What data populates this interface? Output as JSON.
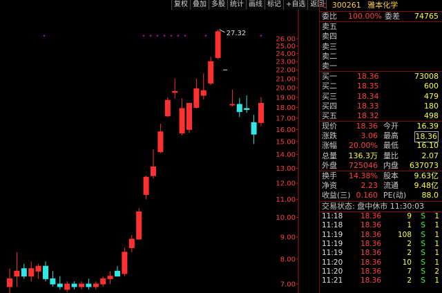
{
  "toolbar": [
    "复权",
    "叠加",
    "多股",
    "统计",
    "画线",
    "标记",
    "+自选",
    "返回"
  ],
  "chart_data": {
    "type": "candlestick",
    "y_ticks": [
      26.0,
      25.0,
      24.0,
      23.0,
      22.0,
      21.0,
      20.0,
      19.0,
      18.0,
      17.0,
      16.0,
      15.0,
      14.0,
      13.0,
      12.0,
      11.0,
      10.0,
      9.0,
      8.0,
      7.0
    ],
    "peak_label": "27.32",
    "candles": [
      {
        "o": 6.9,
        "h": 7.6,
        "l": 6.6,
        "c": 7.2
      },
      {
        "o": 7.3,
        "h": 8.3,
        "l": 6.9,
        "c": 7.5
      },
      {
        "o": 7.6,
        "h": 7.8,
        "l": 7.2,
        "c": 7.3
      },
      {
        "o": 7.3,
        "h": 7.9,
        "l": 7.1,
        "c": 7.6
      },
      {
        "o": 7.5,
        "h": 7.8,
        "l": 7.2,
        "c": 7.7
      },
      {
        "o": 7.7,
        "h": 7.9,
        "l": 7.1,
        "c": 7.2
      },
      {
        "o": 7.2,
        "h": 7.5,
        "l": 6.9,
        "c": 7.0
      },
      {
        "o": 7.0,
        "h": 7.3,
        "l": 6.8,
        "c": 6.9
      },
      {
        "o": 6.8,
        "h": 7.1,
        "l": 6.7,
        "c": 7.0
      },
      {
        "o": 7.0,
        "h": 7.1,
        "l": 6.8,
        "c": 6.9
      },
      {
        "o": 6.9,
        "h": 7.1,
        "l": 6.8,
        "c": 7.0
      },
      {
        "o": 7.0,
        "h": 7.2,
        "l": 6.8,
        "c": 6.9
      },
      {
        "o": 6.9,
        "h": 7.1,
        "l": 6.8,
        "c": 7.0
      },
      {
        "o": 7.0,
        "h": 7.3,
        "l": 6.9,
        "c": 7.2
      },
      {
        "o": 7.2,
        "h": 7.5,
        "l": 7.0,
        "c": 7.3
      },
      {
        "o": 7.5,
        "h": 7.7,
        "l": 7.3,
        "c": 7.3
      },
      {
        "o": 7.4,
        "h": 8.5,
        "l": 7.3,
        "c": 8.3
      },
      {
        "o": 8.5,
        "h": 9.1,
        "l": 8.3,
        "c": 8.9
      },
      {
        "o": 8.9,
        "h": 10.5,
        "l": 8.9,
        "c": 10.3
      },
      {
        "o": 11.3,
        "h": 12.5,
        "l": 11.0,
        "c": 12.4
      },
      {
        "o": 12.5,
        "h": 14.4,
        "l": 12.3,
        "c": 13.1
      },
      {
        "o": 14.2,
        "h": 16.5,
        "l": 14.1,
        "c": 15.8
      },
      {
        "o": 17.2,
        "h": 19.0,
        "l": 17.1,
        "c": 18.7
      },
      {
        "o": 19.5,
        "h": 21.0,
        "l": 18.9,
        "c": 19.6
      },
      {
        "o": 15.7,
        "h": 18.9,
        "l": 15.5,
        "c": 17.9
      },
      {
        "o": 16.0,
        "h": 18.3,
        "l": 15.7,
        "c": 18.4
      },
      {
        "o": 18.0,
        "h": 21.0,
        "l": 17.9,
        "c": 19.9
      },
      {
        "o": 19.2,
        "h": 21.6,
        "l": 18.8,
        "c": 19.7
      },
      {
        "o": 20.5,
        "h": 23.6,
        "l": 20.3,
        "c": 23.0
      },
      {
        "o": 23.5,
        "h": 27.3,
        "l": 23.3,
        "c": 27.0
      },
      {
        "o": 22.0,
        "h": 22.0,
        "l": 22.0,
        "c": 22.0
      },
      {
        "o": 18.3,
        "h": 19.8,
        "l": 18.1,
        "c": 18.3
      },
      {
        "o": 18.3,
        "h": 18.9,
        "l": 17.1,
        "c": 17.6
      },
      {
        "o": 17.9,
        "h": 19.2,
        "l": 17.5,
        "c": 17.8
      },
      {
        "o": 16.6,
        "h": 17.3,
        "l": 14.8,
        "c": 15.6
      },
      {
        "o": 16.6,
        "h": 19.0,
        "l": 16.3,
        "c": 18.4
      }
    ],
    "dots_y": 24.0
  },
  "header": {
    "code": "300261",
    "name": "雅本化学"
  },
  "ratio": {
    "label1": "委比",
    "val1": "100.00%",
    "label2": "委差",
    "val2": "74765"
  },
  "sells": [
    "卖五",
    "卖四",
    "卖三",
    "卖二",
    "卖一"
  ],
  "buys": [
    {
      "label": "买一",
      "price": "18.36",
      "vol": "73008"
    },
    {
      "label": "买二",
      "price": "18.35",
      "vol": "600"
    },
    {
      "label": "买三",
      "price": "18.34",
      "vol": "479"
    },
    {
      "label": "买四",
      "price": "18.33",
      "vol": "180"
    },
    {
      "label": "买五",
      "price": "18.32",
      "vol": "498"
    }
  ],
  "stats": [
    {
      "l1": "现价",
      "v1": "18.36",
      "l2": "今开",
      "v2": "16.39"
    },
    {
      "l1": "涨跌",
      "v1": "3.06",
      "l2": "最高",
      "v2": "18.36"
    },
    {
      "l1": "涨幅",
      "v1": "20.00%",
      "l2": "最低",
      "v2": "16.10"
    },
    {
      "l1": "总量",
      "v1": "136.3万",
      "l2": "量比",
      "v2": "2.07"
    },
    {
      "l1": "外盘",
      "v1": "725046",
      "l2": "内盘",
      "v2": "637073"
    }
  ],
  "stats2": [
    {
      "l1": "换手",
      "v1": "14.38%",
      "l2": "股本",
      "v2": "9.63亿"
    },
    {
      "l1": "净资",
      "v1": "2.23",
      "l2": "流通",
      "v2": "9.48亿"
    },
    {
      "l1": "收益(三)",
      "v1": "0.160",
      "l2": "PE(动)",
      "v2": "88.0"
    }
  ],
  "trade_status": "交易状态: 盘中休市 11:30:03",
  "ticks": [
    {
      "t": "11:18",
      "p": "18.36",
      "v": "9",
      "s": "S",
      "n": "1"
    },
    {
      "t": "11:18",
      "p": "18.36",
      "v": "1",
      "s": "S",
      "n": "1"
    },
    {
      "t": "11:19",
      "p": "18.36",
      "v": "108",
      "s": "S",
      "n": "1"
    },
    {
      "t": "11:19",
      "p": "18.36",
      "v": "2",
      "s": "S",
      "n": "1"
    },
    {
      "t": "11:19",
      "p": "18.36",
      "v": "2",
      "s": "S",
      "n": "1"
    },
    {
      "t": "11:20",
      "p": "18.36",
      "v": "10",
      "s": "S",
      "n": "1"
    },
    {
      "t": "11:20",
      "p": "18.36",
      "v": "7",
      "s": "S",
      "n": "2"
    },
    {
      "t": "11:21",
      "p": "18.36",
      "v": "2",
      "s": "S",
      "n": "1"
    }
  ]
}
